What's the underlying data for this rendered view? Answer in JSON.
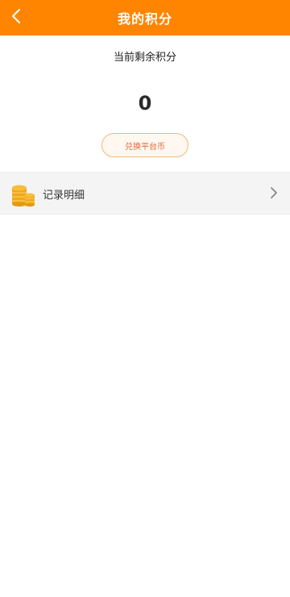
{
  "header": {
    "title": "我的积分",
    "back_icon": "back-arrow-icon",
    "background": "#ff8400"
  },
  "balance": {
    "label": "当前剩余积分",
    "value": "0"
  },
  "exchange_button": {
    "label": "兑换平台币",
    "text_color": "#e5663a",
    "border_color": "#f4b872"
  },
  "records": {
    "label": "记录明细",
    "icon": "coins-icon",
    "chevron": "chevron-right-icon"
  }
}
